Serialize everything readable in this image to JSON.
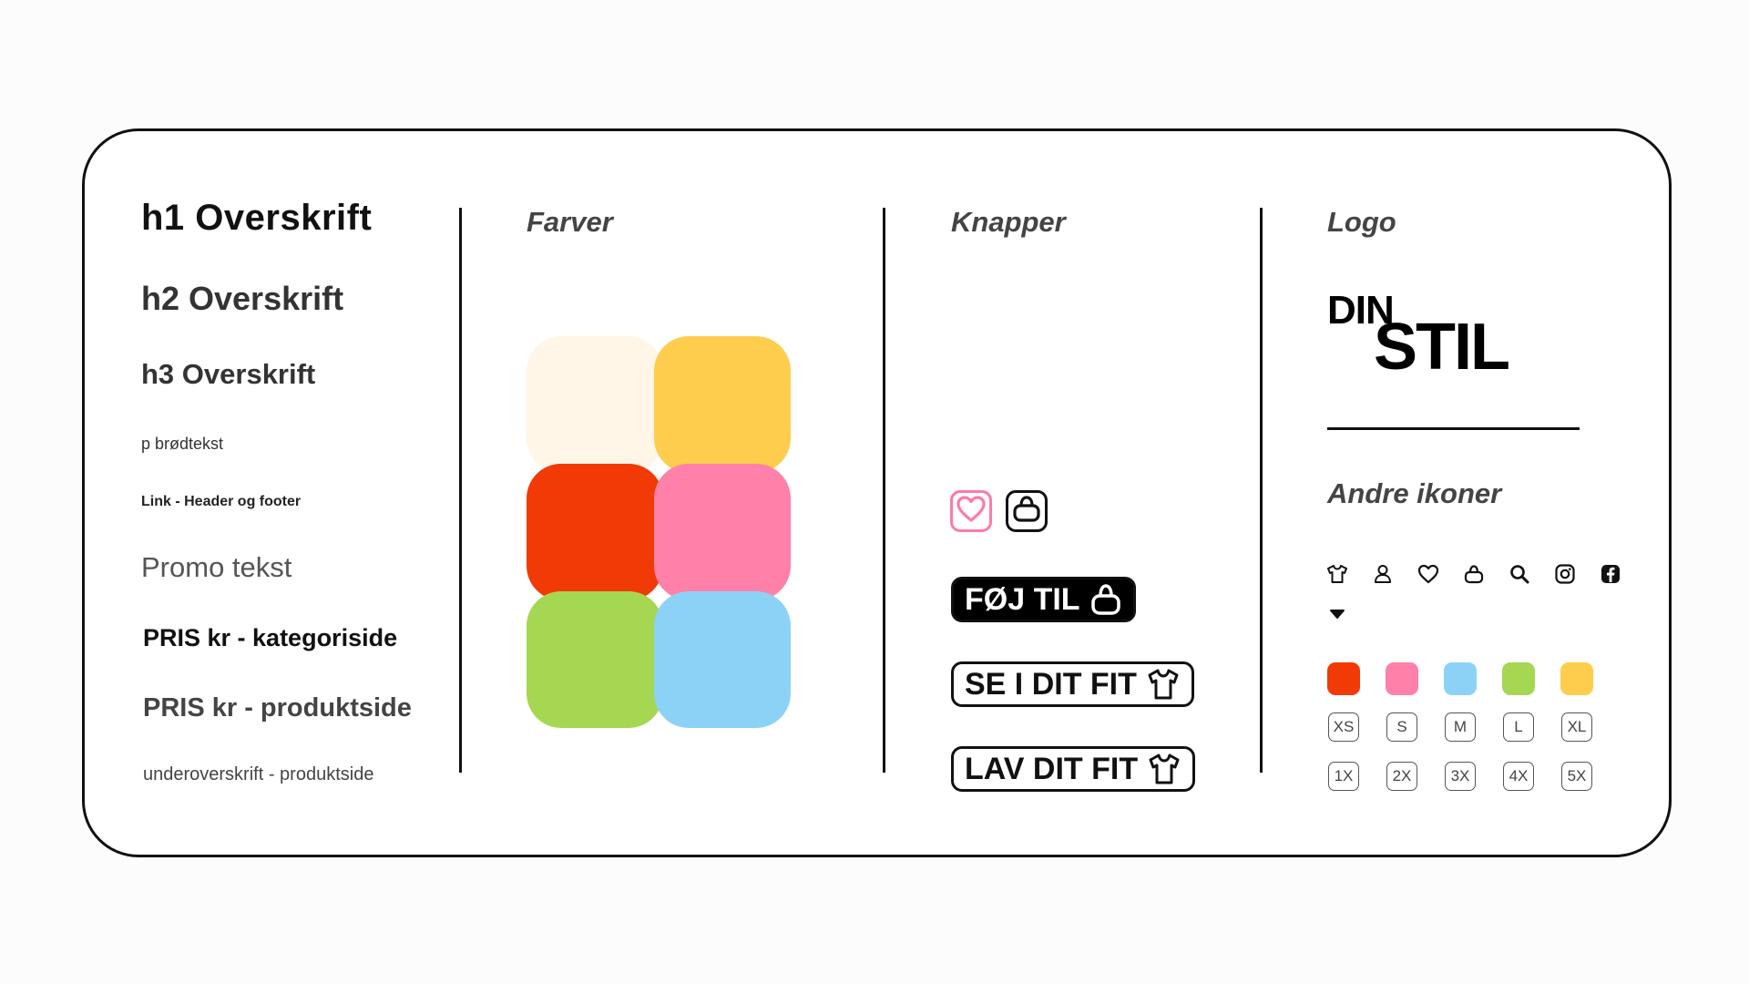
{
  "typography": {
    "h1": "h1 Overskrift",
    "h2": "h2 Overskrift",
    "h3": "h3 Overskrift",
    "p": "p brødtekst",
    "link": "Link - Header og footer",
    "promo": "Promo tekst",
    "price_category": "PRIS kr - kategoriside",
    "price_product": "PRIS kr - produktside",
    "subheading_product": "underoverskrift - produktside"
  },
  "colors": {
    "title": "Farver",
    "swatches": [
      "#fff6e8",
      "#ffcd4d",
      "#f23a06",
      "#ff80a8",
      "#a5d752",
      "#8cd2f6"
    ]
  },
  "buttons": {
    "title": "Knapper",
    "heart_icon": "heart-icon",
    "basket_icon": "basket-icon",
    "add_to_cart": "FØJ TIL",
    "see_in_fit": "SE I DIT FIT",
    "make_fit": "LAV DIT FIT"
  },
  "logo": {
    "title": "Logo",
    "line1": "DIN",
    "line2": "STIL"
  },
  "other_icons": {
    "title": "Andre ikoner",
    "icons": [
      "shirt-icon",
      "user-icon",
      "heart-icon",
      "basket-icon",
      "search-icon",
      "instagram-icon",
      "facebook-icon",
      "caret-down-icon"
    ],
    "color_dots": [
      "#f23a06",
      "#ff80a8",
      "#8cd2f6",
      "#a5d752",
      "#ffcd4d"
    ],
    "sizes_row1": [
      "XS",
      "S",
      "M",
      "L",
      "XL"
    ],
    "sizes_row2": [
      "1X",
      "2X",
      "3X",
      "4X",
      "5X"
    ]
  }
}
